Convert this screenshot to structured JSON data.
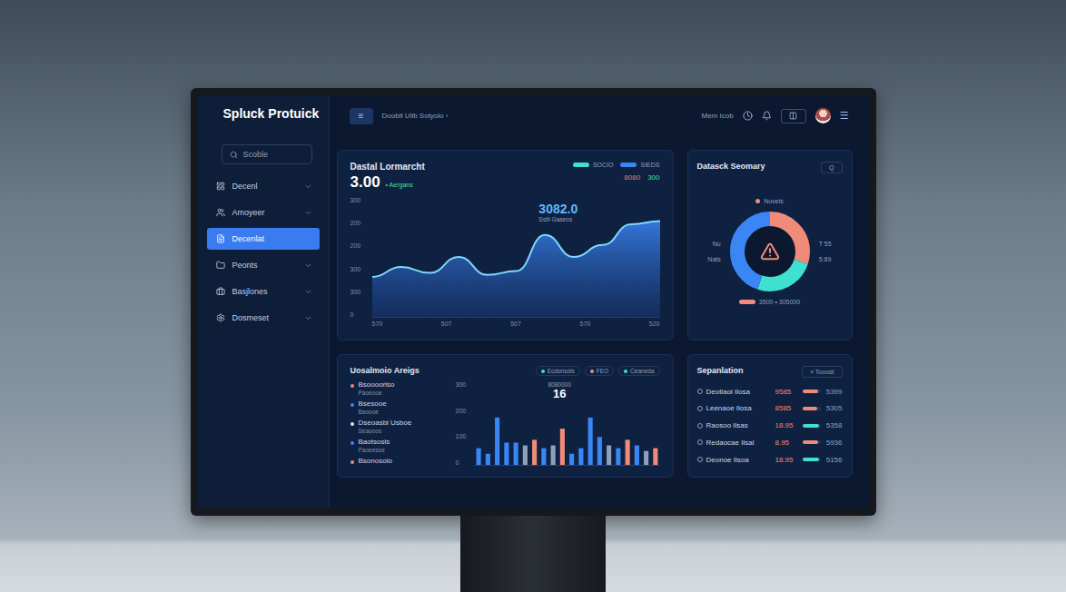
{
  "app": {
    "logo": "Spluck Protuick",
    "search": {
      "placeholder": "Scoble"
    },
    "sidebar": {
      "items": [
        {
          "label": "Decenl",
          "selected": false,
          "expandable": true
        },
        {
          "label": "Amoyeer",
          "selected": false,
          "expandable": true
        },
        {
          "label": "Decenlat",
          "selected": true,
          "expandable": false
        },
        {
          "label": "Peonts",
          "selected": false,
          "expandable": true
        },
        {
          "label": "Basjlones",
          "selected": false,
          "expandable": true
        },
        {
          "label": "Dosmeset",
          "selected": false,
          "expandable": true
        }
      ]
    },
    "topbar": {
      "menu": "≡",
      "breadcrumb": "Dooblt Ullb Sotyolo ›",
      "link": "Mem Icob",
      "more": "☰"
    },
    "trend": {
      "title": "Dastal Lormarcht",
      "value": "3.00",
      "delta": "• Aergans",
      "legend": [
        {
          "label": "SOCIO",
          "color": "#3fe0d0"
        },
        {
          "label": "SIEDS",
          "color": "#3a86f5"
        }
      ],
      "stats": [
        {
          "text": "8080",
          "color": "#f0776a"
        },
        {
          "text": "300",
          "color": "#3fe0a0"
        }
      ],
      "y_ticks": [
        "300",
        "200",
        "200",
        "300",
        "300",
        "0"
      ],
      "x_ticks": [
        "570",
        "507",
        "507",
        "570",
        "520"
      ],
      "annotation": {
        "value": "3082.0",
        "label": "Sstil Gaaeos"
      },
      "series": [
        {
          "name": "SOCIO",
          "values": [
            100,
            125,
            110,
            150,
            105,
            115,
            205,
            150,
            180,
            232,
            240
          ]
        }
      ]
    },
    "summary": {
      "title": "Datasck Seomary",
      "filter": "Q",
      "top_label": {
        "text": "Nuvels",
        "color": "#f08b7a"
      },
      "left_labels": [
        "Nu",
        "Nats"
      ],
      "right_labels": [
        "T 55",
        "5.89"
      ],
      "legend": {
        "text": "3500 • 305000",
        "color": "#f08b7a"
      },
      "segments": [
        {
          "value": 30,
          "color": "#f08b7a"
        },
        {
          "value": 25,
          "color": "#3fe0d0"
        },
        {
          "value": 45,
          "color": "#3a86f5"
        }
      ]
    },
    "activity": {
      "title": "Uosalmoio Areigs",
      "legend": [
        {
          "label": "Ecdonsols",
          "color": "#3fe0d0"
        },
        {
          "label": "FEO",
          "color": "#f08b7a"
        },
        {
          "label": "Ceaneda",
          "color": "#3fe0d0"
        }
      ],
      "items": [
        {
          "title": "Bsoooorlso",
          "sub": "Paoeooe",
          "color": "#f08b7a"
        },
        {
          "title": "Bsesooe",
          "sub": "Baoooe",
          "color": "#3a86f5"
        },
        {
          "title": "Dseoasbl Usboe",
          "sub": "Seaooos",
          "color": "#dfe6f2"
        },
        {
          "title": "Baotsosls",
          "sub": "Paoeesoe",
          "color": "#3a86f5"
        },
        {
          "title": "Bsonosolo",
          "sub": "",
          "color": "#f08b7a"
        }
      ],
      "y_ticks": [
        "300",
        "200",
        "100",
        "0"
      ],
      "annotation": {
        "label": "8080000",
        "value": "16"
      },
      "bars": [
        {
          "value": 60,
          "color": "#3a86f5"
        },
        {
          "value": 40,
          "color": "#3a86f5"
        },
        {
          "value": 170,
          "color": "#3a86f5"
        },
        {
          "value": 80,
          "color": "#3a86f5"
        },
        {
          "value": 80,
          "color": "#3a86f5"
        },
        {
          "value": 70,
          "color": "#8fa0bb"
        },
        {
          "value": 90,
          "color": "#f08b7a"
        },
        {
          "value": 60,
          "color": "#3a86f5"
        },
        {
          "value": 70,
          "color": "#8fa0bb"
        },
        {
          "value": 130,
          "color": "#f08b7a"
        },
        {
          "value": 40,
          "color": "#3a86f5"
        },
        {
          "value": 60,
          "color": "#3a86f5"
        },
        {
          "value": 170,
          "color": "#3a86f5"
        },
        {
          "value": 100,
          "color": "#3a86f5"
        },
        {
          "value": 70,
          "color": "#8fa0bb"
        },
        {
          "value": 60,
          "color": "#3a86f5"
        },
        {
          "value": 90,
          "color": "#f08b7a"
        },
        {
          "value": 70,
          "color": "#3a86f5"
        },
        {
          "value": 50,
          "color": "#8fa0bb"
        },
        {
          "value": 60,
          "color": "#f08b7a"
        }
      ]
    },
    "separation": {
      "title": "Sepanlation",
      "button": "≡ Tooost",
      "rows": [
        {
          "name": "Deotiaol Ilosa",
          "value": "9585",
          "level": 0.85,
          "reading": "5399",
          "color": "#f08b7a"
        },
        {
          "name": "Leenaoe Ilosa",
          "value": "8585",
          "level": 0.8,
          "reading": "5305",
          "color": "#f08b7a"
        },
        {
          "name": "Raosoo Ilsas",
          "value": "18.95",
          "level": 0.9,
          "reading": "5358",
          "color": "#3fe0d0"
        },
        {
          "name": "Redaocae Ilsal",
          "value": "8.95",
          "level": 0.85,
          "reading": "5936",
          "color": "#f08b7a"
        },
        {
          "name": "Deonoe Ilsoa",
          "value": "18.95",
          "level": 0.9,
          "reading": "5156",
          "color": "#3fe0d0"
        }
      ]
    }
  }
}
